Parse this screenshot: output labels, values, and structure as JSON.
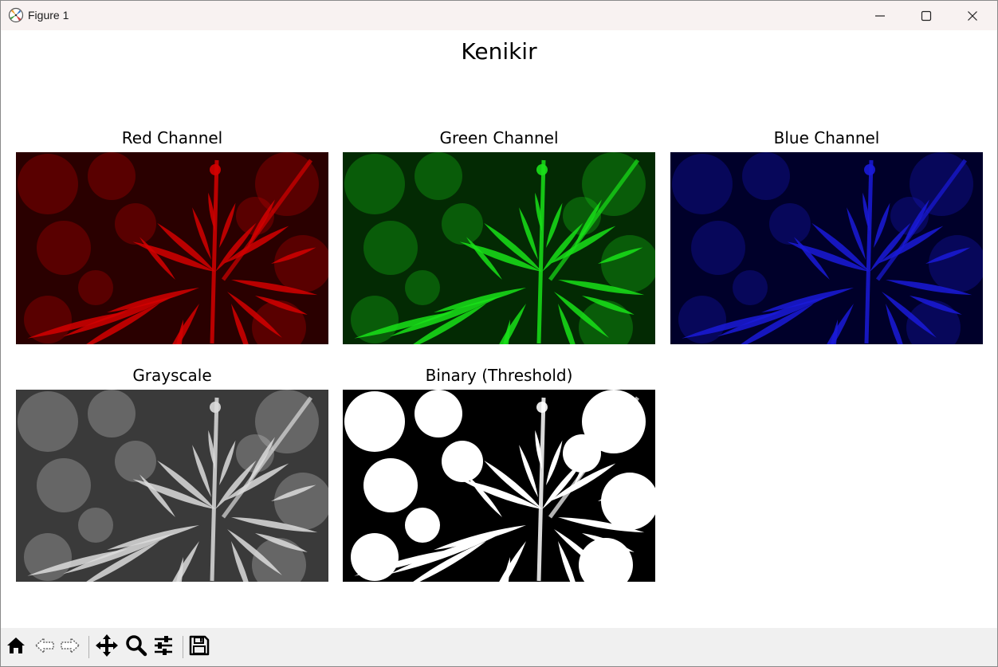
{
  "window": {
    "title": "Figure 1",
    "controls": [
      "minimize-icon",
      "maximize-icon",
      "close-icon"
    ]
  },
  "figure": {
    "suptitle": "Kenikir",
    "panels": [
      {
        "title": "Red Channel",
        "tint": "#d40000",
        "dark": "#2a0000"
      },
      {
        "title": "Green Channel",
        "tint": "#19e019",
        "dark": "#032a03"
      },
      {
        "title": "Blue Channel",
        "tint": "#1a1ad8",
        "dark": "#00002a"
      },
      {
        "title": "Grayscale",
        "tint": "#dcdcdc",
        "dark": "#3a3a3a"
      },
      {
        "title": "Binary (Threshold)",
        "tint": "#ffffff",
        "dark": "#000000"
      }
    ]
  },
  "toolbar": {
    "buttons": [
      "home-icon",
      "back-icon",
      "forward-icon",
      "pan-icon",
      "zoom-icon",
      "configure-subplots-icon",
      "save-icon"
    ]
  }
}
